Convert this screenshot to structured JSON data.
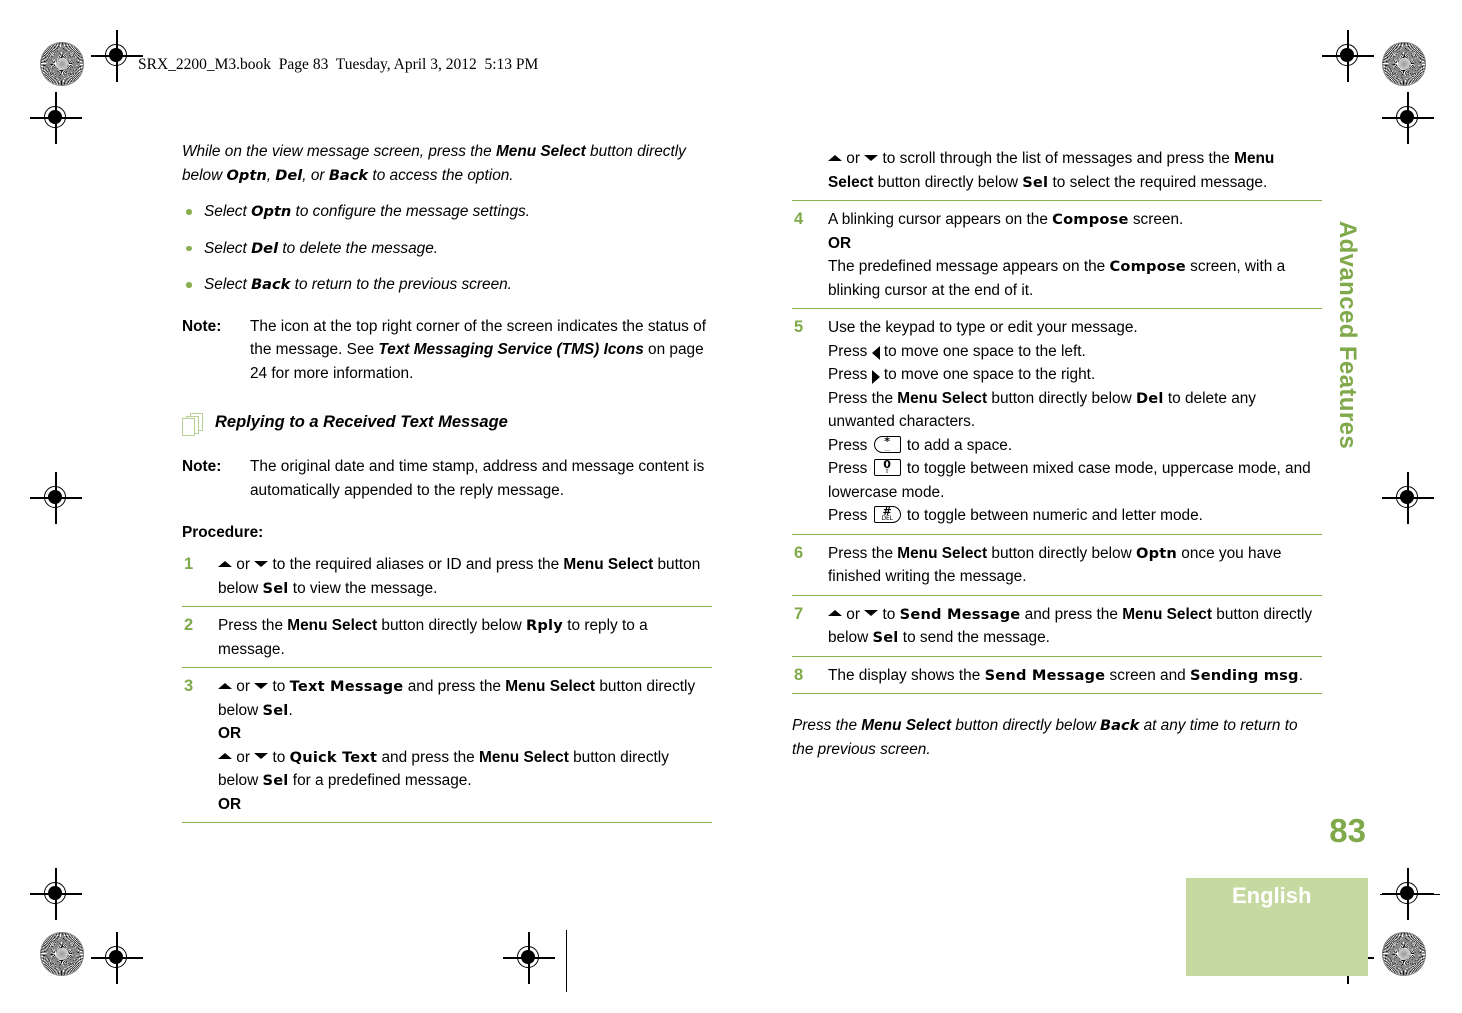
{
  "header": {
    "text": "SRX_2200_M3.book  Page 83  Tuesday, April 3, 2012  5:13 PM"
  },
  "sidebar": {
    "chapter_title": "Advanced Features",
    "page_number": "83",
    "language": "English"
  },
  "colors": {
    "accent_green": "#7fa94a",
    "rule_green": "#8cae52",
    "block_green": "#c5d9a0",
    "icon_green": "#b8d095"
  },
  "left_column": {
    "intro": {
      "part1": "While on the view message screen, press the ",
      "bold1": "Menu Select",
      "part2": " button directly below ",
      "dev1": "Optn",
      "part3": ", ",
      "dev2": "Del",
      "part4": ", or ",
      "dev3": "Back",
      "part5": " to access the option."
    },
    "bullets": [
      {
        "pre": "Select ",
        "dev": "Optn",
        "post": " to configure the message settings."
      },
      {
        "pre": "Select ",
        "dev": "Del",
        "post": " to delete the message."
      },
      {
        "pre": "Select ",
        "dev": "Back",
        "post": " to return to the previous screen."
      }
    ],
    "note1": {
      "label": "Note:",
      "part1": "The icon at the top right corner of the screen indicates the status of the message. See ",
      "bold1": "Text Messaging Service (TMS) Icons",
      "part2": " on page 24 for more information."
    },
    "section_heading": "Replying to a Received Text Message",
    "note2": {
      "label": "Note:",
      "text": "The original date and time stamp, address and message content is automatically appended to the reply message."
    },
    "procedure_label": "Procedure:",
    "steps": [
      {
        "num": "1",
        "lines": [
          {
            "segments": [
              {
                "type": "arrow",
                "dir": "up"
              },
              {
                "type": "text",
                "text": " or "
              },
              {
                "type": "arrow",
                "dir": "down"
              },
              {
                "type": "text",
                "text": " to the required aliases or ID and press the "
              },
              {
                "type": "bold",
                "text": "Menu Select"
              },
              {
                "type": "text",
                "text": " button below "
              },
              {
                "type": "dev",
                "text": "Sel"
              },
              {
                "type": "text",
                "text": " to view the message."
              }
            ]
          }
        ]
      },
      {
        "num": "2",
        "lines": [
          {
            "segments": [
              {
                "type": "text",
                "text": "Press the "
              },
              {
                "type": "bold",
                "text": "Menu Select"
              },
              {
                "type": "text",
                "text": " button directly below "
              },
              {
                "type": "dev",
                "text": "Rply"
              },
              {
                "type": "text",
                "text": " to reply to a message."
              }
            ]
          }
        ]
      },
      {
        "num": "3",
        "lines": [
          {
            "segments": [
              {
                "type": "arrow",
                "dir": "up"
              },
              {
                "type": "text",
                "text": " or "
              },
              {
                "type": "arrow",
                "dir": "down"
              },
              {
                "type": "text",
                "text": " to "
              },
              {
                "type": "dev",
                "text": "Text Message"
              },
              {
                "type": "text",
                "text": " and press the "
              },
              {
                "type": "bold",
                "text": "Menu Select"
              },
              {
                "type": "text",
                "text": " button directly below "
              },
              {
                "type": "dev",
                "text": "Sel"
              },
              {
                "type": "text",
                "text": "."
              }
            ]
          },
          {
            "segments": [
              {
                "type": "or",
                "text": "OR"
              }
            ]
          },
          {
            "segments": [
              {
                "type": "arrow",
                "dir": "up"
              },
              {
                "type": "text",
                "text": " or "
              },
              {
                "type": "arrow",
                "dir": "down"
              },
              {
                "type": "text",
                "text": " to "
              },
              {
                "type": "dev",
                "text": "Quick Text"
              },
              {
                "type": "text",
                "text": " and press the "
              },
              {
                "type": "bold",
                "text": "Menu Select"
              },
              {
                "type": "text",
                "text": " button directly below "
              },
              {
                "type": "dev",
                "text": "Sel"
              },
              {
                "type": "text",
                "text": " for a predefined message."
              }
            ]
          },
          {
            "segments": [
              {
                "type": "or",
                "text": "OR"
              }
            ]
          }
        ]
      }
    ]
  },
  "right_column": {
    "steps": [
      {
        "num": "",
        "lines": [
          {
            "segments": [
              {
                "type": "arrow",
                "dir": "up"
              },
              {
                "type": "text",
                "text": " or "
              },
              {
                "type": "arrow",
                "dir": "down"
              },
              {
                "type": "text",
                "text": " to scroll through the list of messages and press the "
              },
              {
                "type": "bold",
                "text": "Menu Select"
              },
              {
                "type": "text",
                "text": " button directly below "
              },
              {
                "type": "dev",
                "text": "Sel"
              },
              {
                "type": "text",
                "text": " to select the required message."
              }
            ]
          }
        ]
      },
      {
        "num": "4",
        "lines": [
          {
            "segments": [
              {
                "type": "text",
                "text": "A blinking cursor appears on the "
              },
              {
                "type": "dev",
                "text": "Compose"
              },
              {
                "type": "text",
                "text": " screen."
              }
            ]
          },
          {
            "segments": [
              {
                "type": "or",
                "text": "OR"
              }
            ]
          },
          {
            "segments": [
              {
                "type": "text",
                "text": "The predefined message appears on the "
              },
              {
                "type": "dev",
                "text": "Compose"
              },
              {
                "type": "text",
                "text": " screen, with a blinking cursor at the end of it."
              }
            ]
          }
        ]
      },
      {
        "num": "5",
        "lines": [
          {
            "segments": [
              {
                "type": "text",
                "text": "Use the keypad to type or edit your message."
              }
            ]
          },
          {
            "segments": [
              {
                "type": "text",
                "text": "Press "
              },
              {
                "type": "arrow",
                "dir": "left"
              },
              {
                "type": "text",
                "text": " to move one space to the left."
              }
            ]
          },
          {
            "segments": [
              {
                "type": "text",
                "text": "Press "
              },
              {
                "type": "arrow",
                "dir": "right"
              },
              {
                "type": "text",
                "text": " to move one space to the right."
              }
            ]
          },
          {
            "segments": [
              {
                "type": "text",
                "text": "Press the "
              },
              {
                "type": "bold",
                "text": "Menu Select"
              },
              {
                "type": "text",
                "text": " button directly below "
              },
              {
                "type": "dev",
                "text": "Del"
              },
              {
                "type": "text",
                "text": " to delete any unwanted characters."
              }
            ]
          },
          {
            "segments": [
              {
                "type": "text",
                "text": "Press "
              },
              {
                "type": "key",
                "shape": "round-l",
                "top": "*",
                "bottom": "＿"
              },
              {
                "type": "text",
                "text": " to add a space."
              }
            ]
          },
          {
            "segments": [
              {
                "type": "text",
                "text": "Press "
              },
              {
                "type": "key",
                "shape": "square",
                "top": "0",
                "bottom": "⇧"
              },
              {
                "type": "text",
                "text": " to toggle between mixed case mode, uppercase mode, and lowercase mode."
              }
            ]
          },
          {
            "segments": [
              {
                "type": "text",
                "text": "Press "
              },
              {
                "type": "key",
                "shape": "round-r",
                "top": "#",
                "bottom": "DEL"
              },
              {
                "type": "text",
                "text": " to toggle between numeric and letter mode."
              }
            ]
          }
        ]
      },
      {
        "num": "6",
        "lines": [
          {
            "segments": [
              {
                "type": "text",
                "text": "Press the "
              },
              {
                "type": "bold",
                "text": "Menu Select"
              },
              {
                "type": "text",
                "text": " button directly below "
              },
              {
                "type": "dev",
                "text": "Optn"
              },
              {
                "type": "text",
                "text": " once you have finished writing the message."
              }
            ]
          }
        ]
      },
      {
        "num": "7",
        "lines": [
          {
            "segments": [
              {
                "type": "arrow",
                "dir": "up"
              },
              {
                "type": "text",
                "text": " or "
              },
              {
                "type": "arrow",
                "dir": "down"
              },
              {
                "type": "text",
                "text": " to "
              },
              {
                "type": "dev",
                "text": "Send Message"
              },
              {
                "type": "text",
                "text": " and press the "
              },
              {
                "type": "bold",
                "text": "Menu Select"
              },
              {
                "type": "text",
                "text": " button directly below "
              },
              {
                "type": "dev",
                "text": "Sel"
              },
              {
                "type": "text",
                "text": " to send the message."
              }
            ]
          }
        ]
      },
      {
        "num": "8",
        "lines": [
          {
            "segments": [
              {
                "type": "text",
                "text": "The display shows the "
              },
              {
                "type": "dev",
                "text": "Send Message"
              },
              {
                "type": "text",
                "text": " screen and "
              },
              {
                "type": "dev",
                "text": "Sending msg"
              },
              {
                "type": "text",
                "text": "."
              }
            ]
          }
        ]
      }
    ],
    "closing": {
      "part1": "Press the ",
      "bold1": "Menu Select",
      "part2": " button directly below ",
      "dev1": "Back",
      "part3": " at any time to return to the previous screen."
    }
  }
}
